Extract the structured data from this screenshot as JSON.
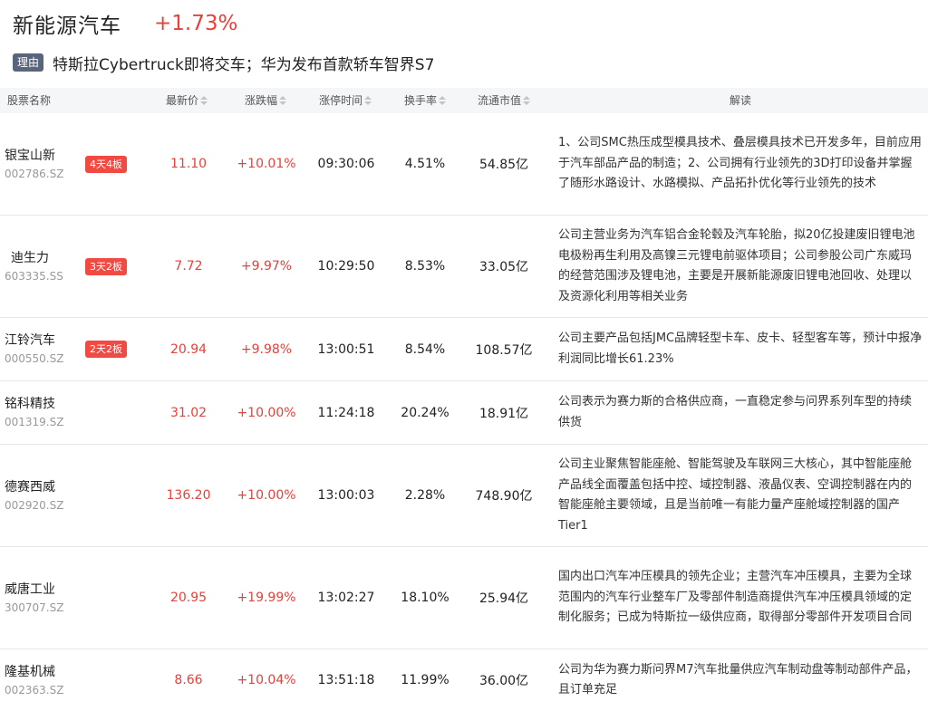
{
  "sector": {
    "name": "新能源汽车",
    "change": "+1.73%"
  },
  "reason": {
    "tag": "理由",
    "text": "特斯拉Cybertruck即将交车；华为发布首款轿车智界S7"
  },
  "table": {
    "headers": {
      "name": "股票名称",
      "price": "最新价",
      "change": "涨跌幅",
      "limit_time": "涨停时间",
      "turnover": "换手率",
      "market_cap": "流通市值",
      "desc": "解读"
    },
    "rows": [
      {
        "name": "银宝山新",
        "code": "002786.SZ",
        "badge": "4天4板",
        "price": "11.10",
        "change": "+10.01%",
        "limit_time": "09:30:06",
        "turnover": "4.51%",
        "market_cap": "54.85亿",
        "desc": "1、公司SMC热压成型模具技术、叠层模具技术已开发多年，目前应用于汽车部品产品的制造；2、公司拥有行业领先的3D打印设备并掌握了随形水路设计、水路模拟、产品拓扑优化等行业领先的技术"
      },
      {
        "name": "迪生力",
        "code": "603335.SS",
        "badge": "3天2板",
        "price": "7.72",
        "change": "+9.97%",
        "limit_time": "10:29:50",
        "turnover": "8.53%",
        "market_cap": "33.05亿",
        "desc": "公司主营业务为汽车铝合金轮毂及汽车轮胎，拟20亿投建废旧锂电池电极粉再生利用及高镍三元锂电前驱体项目；公司参股公司广东威玛的经营范围涉及锂电池，主要是开展新能源废旧锂电池回收、处理以及资源化利用等相关业务"
      },
      {
        "name": "江铃汽车",
        "code": "000550.SZ",
        "badge": "2天2板",
        "price": "20.94",
        "change": "+9.98%",
        "limit_time": "13:00:51",
        "turnover": "8.54%",
        "market_cap": "108.57亿",
        "desc": "公司主要产品包括JMC品牌轻型卡车、皮卡、轻型客车等，预计中报净利润同比增长61.23%"
      },
      {
        "name": "铭科精技",
        "code": "001319.SZ",
        "badge": "",
        "price": "31.02",
        "change": "+10.00%",
        "limit_time": "11:24:18",
        "turnover": "20.24%",
        "market_cap": "18.91亿",
        "desc": "公司表示为赛力斯的合格供应商，一直稳定参与问界系列车型的持续供货"
      },
      {
        "name": "德赛西威",
        "code": "002920.SZ",
        "badge": "",
        "price": "136.20",
        "change": "+10.00%",
        "limit_time": "13:00:03",
        "turnover": "2.28%",
        "market_cap": "748.90亿",
        "desc": "公司主业聚焦智能座舱、智能驾驶及车联网三大核心，其中智能座舱产品线全面覆盖包括中控、域控制器、液晶仪表、空调控制器在内的智能座舱主要领域，且是当前唯一有能力量产座舱域控制器的国产Tier1"
      },
      {
        "name": "威唐工业",
        "code": "300707.SZ",
        "badge": "",
        "price": "20.95",
        "change": "+19.99%",
        "limit_time": "13:02:27",
        "turnover": "18.10%",
        "market_cap": "25.94亿",
        "desc": "国内出口汽车冲压模具的领先企业；主营汽车冲压模具，主要为全球范围内的汽车行业整车厂及零部件制造商提供汽车冲压模具领域的定制化服务；已成为特斯拉一级供应商，取得部分零部件开发项目合同"
      },
      {
        "name": "隆基机械",
        "code": "002363.SZ",
        "badge": "",
        "price": "8.66",
        "change": "+10.04%",
        "limit_time": "13:51:18",
        "turnover": "11.99%",
        "market_cap": "36.00亿",
        "desc": "公司为华为赛力斯问界M7汽车批量供应汽车制动盘等制动部件产品，且订单充足"
      }
    ]
  }
}
